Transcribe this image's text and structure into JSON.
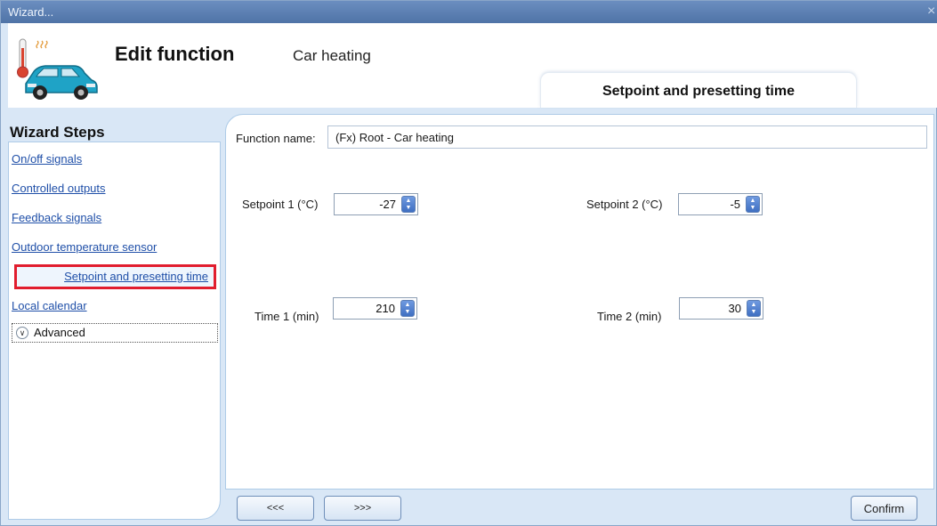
{
  "window": {
    "title": "Wizard...",
    "close_glyph": "×"
  },
  "header": {
    "title": "Edit function",
    "subtitle": "Car heating",
    "icon": "car-heating-icon",
    "tab_label": "Setpoint and presetting time"
  },
  "sidebar": {
    "heading": "Wizard Steps",
    "steps": [
      {
        "label": "On/off signals",
        "selected": false
      },
      {
        "label": "Controlled outputs",
        "selected": false
      },
      {
        "label": "Feedback signals",
        "selected": false
      },
      {
        "label": "Outdoor temperature sensor",
        "selected": false
      },
      {
        "label": "Setpoint and presetting time",
        "selected": true
      },
      {
        "label": "Local calendar",
        "selected": false
      }
    ],
    "advanced_label": "Advanced",
    "highlight_color": "#e11d2e"
  },
  "form": {
    "function_name_label": "Function name:",
    "function_name_value": "(Fx) Root - Car heating",
    "setpoint1": {
      "label": "Setpoint 1 (°C)",
      "value": "-27"
    },
    "setpoint2": {
      "label": "Setpoint 2 (°C)",
      "value": "-5"
    },
    "time1": {
      "label": "Time 1 (min)",
      "value": "210"
    },
    "time2": {
      "label": "Time 2 (min)",
      "value": "30"
    }
  },
  "footer": {
    "back_label": "<<<",
    "next_label": ">>>",
    "confirm_label": "Confirm"
  }
}
